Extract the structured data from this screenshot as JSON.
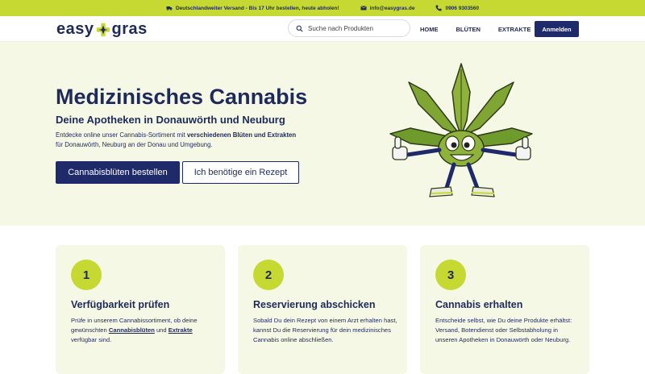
{
  "topbar": {
    "shipping": "Deutschlandweiter Versand - Bis 17 Uhr bestellen, heute abholen!",
    "email": "info@easygras.de",
    "phone": "0906 9303560"
  },
  "header": {
    "logo_left": "easy",
    "logo_right": "gras",
    "search_placeholder": "Suche nach Produkten",
    "nav": [
      "HOME",
      "BLÜTEN",
      "EXTRAKTE"
    ],
    "login_label": "Anmelden"
  },
  "hero": {
    "title": "Medizinisches Cannabis",
    "subtitle": "Deine Apotheken in Donauwörth und Neuburg",
    "text_a": "Entdecke online unser Cannabis-Sortiment mit ",
    "text_bold": "verschiedenen Blüten und Extrakten",
    "text_b": " für Donauwörth, Neuburg an der Donau und Umgebung.",
    "btn_primary": "Cannabisblüten bestellen",
    "btn_secondary": "Ich benötige ein Rezept"
  },
  "steps": [
    {
      "num": "1",
      "title": "Verfügbarkeit prüfen",
      "text_a": "Prüfe in unserem Cannabissortiment, ob deine gewünschten ",
      "link1": "Cannabisblüten",
      "text_b": " und ",
      "link2": "Extrakte",
      "text_c": " verfügbar sind."
    },
    {
      "num": "2",
      "title": "Reservierung abschicken",
      "text": "Sobald Du dein Rezept von einem Arzt erhalten hast, kannst Du die Reservierung für dein medizinisches Cannabis online abschließen."
    },
    {
      "num": "3",
      "title": "Cannabis erhalten",
      "text": "Entscheide selbst, wie Du deine Produkte erhältst: Versand, Botendienst oder Selbstabholung in unseren Apotheken in Donauwörth oder Neuburg."
    }
  ],
  "colors": {
    "accent_green": "#c6d832",
    "navy": "#1f2a6b",
    "hero_bg": "#f6f8e6"
  }
}
